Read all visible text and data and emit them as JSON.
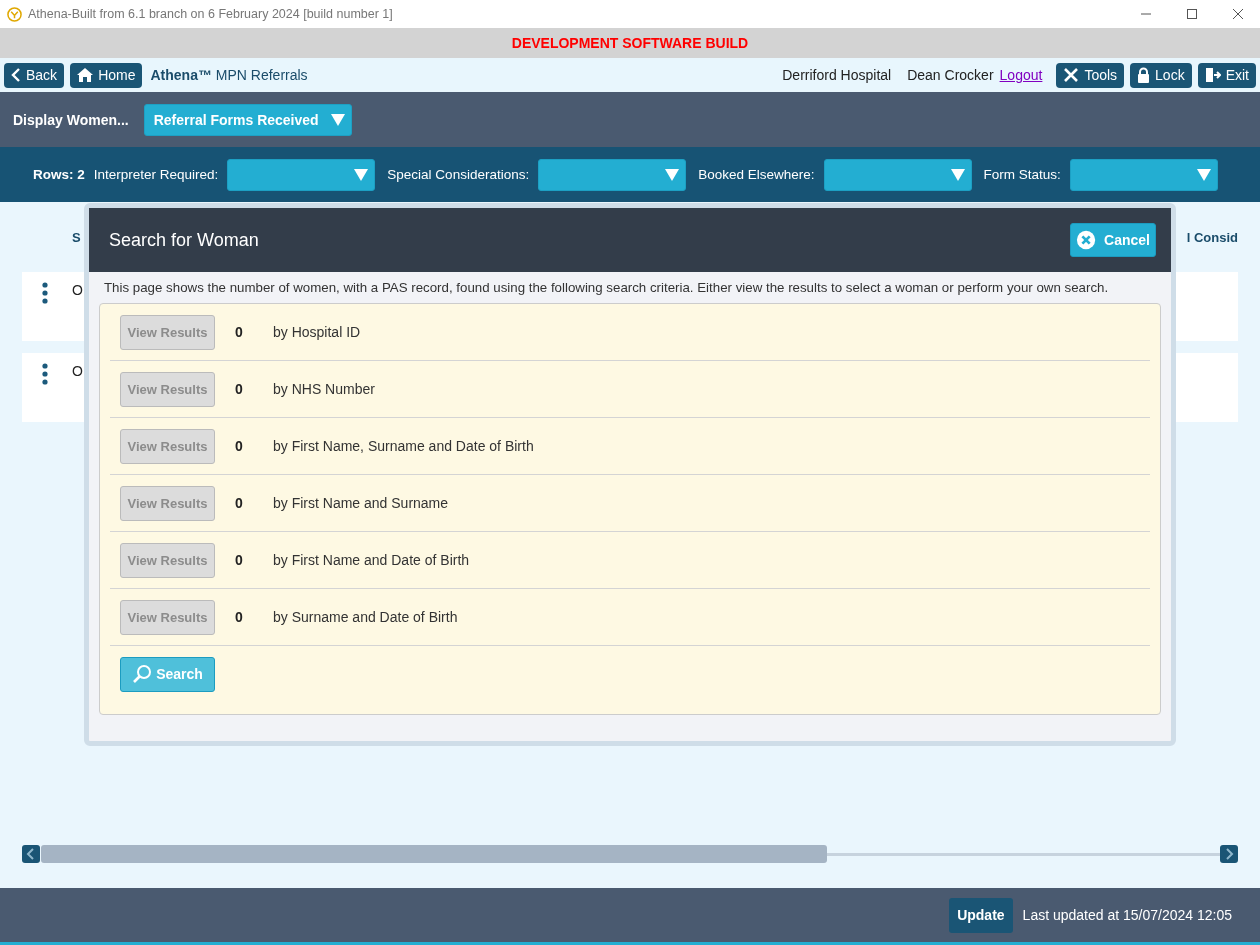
{
  "window": {
    "title": "Athena-Built from 6.1 branch on 6 February 2024 [build number 1]"
  },
  "banner": "DEVELOPMENT SOFTWARE BUILD",
  "nav": {
    "back": "Back",
    "home": "Home",
    "brand": "Athena™",
    "app_name": "MPN Referrals",
    "hospital": "Derriford Hospital",
    "user": "Dean Crocker",
    "logout": "Logout",
    "tools": "Tools",
    "lock": "Lock",
    "exit": "Exit"
  },
  "display": {
    "label": "Display Women...",
    "value": "Referral Forms Received"
  },
  "filters": {
    "rows": "Rows: 2",
    "items": [
      {
        "label": "Interpreter Required:"
      },
      {
        "label": "Special Considerations:"
      },
      {
        "label": "Booked Elsewhere:"
      },
      {
        "label": "Form Status:"
      }
    ]
  },
  "table": {
    "header_left": "S",
    "header_right": "l Consid",
    "rows": [
      {
        "text": "O"
      },
      {
        "text": "O"
      }
    ]
  },
  "dialog": {
    "title": "Search for Woman",
    "cancel": "Cancel",
    "description": "This page shows the number of women, with a PAS record, found using the following search criteria. Either view the results to select a woman or perform your own search.",
    "criteria": [
      {
        "button": "View Results",
        "disabled": true,
        "count": "0",
        "label": "by Hospital ID"
      },
      {
        "button": "View Results",
        "disabled": true,
        "count": "0",
        "label": "by NHS Number"
      },
      {
        "button": "View Results",
        "disabled": true,
        "count": "0",
        "label": "by First Name, Surname and Date of Birth"
      },
      {
        "button": "View Results",
        "disabled": true,
        "count": "0",
        "label": "by First Name and Surname"
      },
      {
        "button": "View Results",
        "disabled": true,
        "count": "0",
        "label": "by First Name and Date of Birth"
      },
      {
        "button": "View Results",
        "disabled": true,
        "count": "0",
        "label": "by Surname and Date of Birth"
      }
    ],
    "search": "Search"
  },
  "footer": {
    "update": "Update",
    "last_updated": "Last updated at 15/07/2024 12:05"
  }
}
